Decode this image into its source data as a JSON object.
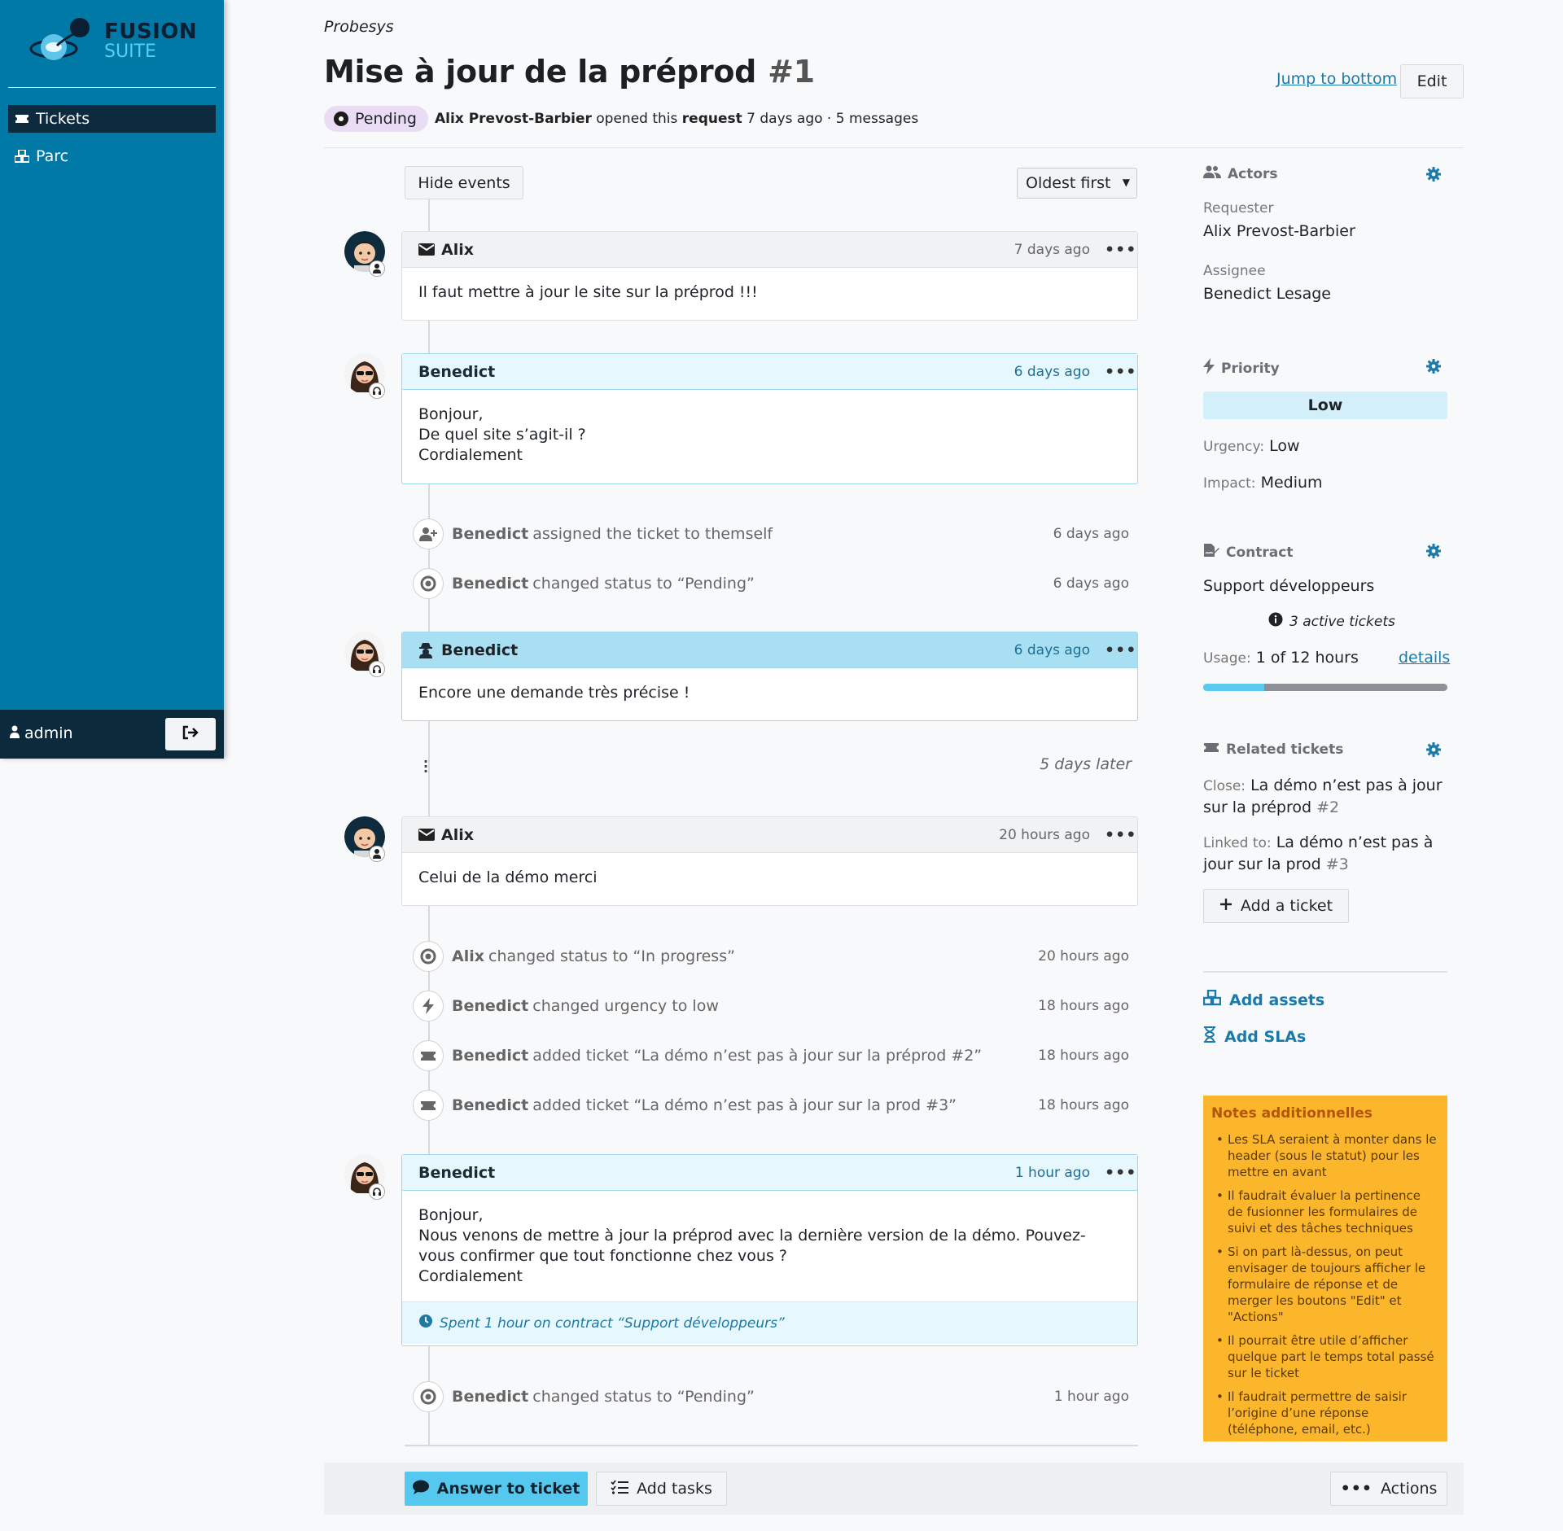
{
  "app": {
    "logo_line1": "FUSION",
    "logo_line2": "SUITE"
  },
  "sidebar": {
    "items": [
      {
        "label": "Tickets",
        "icon": "ticket-icon",
        "active": true
      },
      {
        "label": "Parc",
        "icon": "cubes-icon",
        "active": false
      }
    ],
    "user": "admin"
  },
  "header": {
    "breadcrumb": "Probesys",
    "title": "Mise à jour de la préprod",
    "number": "#1",
    "jump_label": "Jump to bottom",
    "edit_label": "Edit",
    "status": "Pending",
    "author": "Alix Prevost-Barbier",
    "opened_text": "opened this",
    "type": "request",
    "opened_when": "7 days ago · 5 messages"
  },
  "timeline": {
    "hide_events_label": "Hide events",
    "sort_value": "Oldest first",
    "messages": [
      {
        "author": "Alix",
        "time": "7 days ago",
        "lines": [
          "Il faut mettre à jour le site sur la préprod !!!"
        ]
      },
      {
        "author": "Benedict",
        "time": "6 days ago",
        "lines": [
          "Bonjour,",
          "De quel site s’agit-il ?",
          "Cordialement"
        ]
      },
      {
        "author": "Benedict",
        "time": "6 days ago",
        "lines": [
          "Encore une demande très précise !"
        ]
      },
      {
        "author": "Alix",
        "time": "20 hours ago",
        "lines": [
          "Celui de la démo merci"
        ]
      },
      {
        "author": "Benedict",
        "time": "1 hour ago",
        "lines": [
          "Bonjour,",
          "Nous venons de mettre à jour la préprod avec la dernière version de la démo. Pouvez-vous confirmer que tout fonctionne chez vous ?",
          "Cordialement"
        ],
        "footer": "Spent 1 hour on contract “Support développeurs”"
      }
    ],
    "events": [
      {
        "actor": "Benedict",
        "text": "assigned the ticket to themself",
        "time": "6 days ago",
        "icon": "user-plus-icon"
      },
      {
        "actor": "Benedict",
        "text": "changed status to “Pending”",
        "time": "6 days ago",
        "icon": "status-circle-icon"
      },
      {
        "actor": "Alix",
        "text": "changed status to “In progress”",
        "time": "20 hours ago",
        "icon": "status-circle-icon"
      },
      {
        "actor": "Benedict",
        "text": "changed urgency to low",
        "time": "18 hours ago",
        "icon": "bolt-icon"
      },
      {
        "actor": "Benedict",
        "text": "added ticket “La démo n’est pas à jour sur la préprod #2”",
        "time": "18 hours ago",
        "icon": "ticket-icon"
      },
      {
        "actor": "Benedict",
        "text": "added ticket “La démo n’est pas à jour sur la prod #3”",
        "time": "18 hours ago",
        "icon": "ticket-icon"
      },
      {
        "actor": "Benedict",
        "text": "changed status to “Pending”",
        "time": "1 hour ago",
        "icon": "status-circle-icon"
      }
    ],
    "gap_label": "5 days later"
  },
  "actionbar": {
    "answer_label": "Answer to ticket",
    "tasks_label": "Add tasks",
    "actions_label": "Actions"
  },
  "right_panel": {
    "actors": {
      "title": "Actors",
      "requester_label": "Requester",
      "requester": "Alix Prevost-Barbier",
      "assignee_label": "Assignee",
      "assignee": "Benedict Lesage"
    },
    "priority": {
      "title": "Priority",
      "value": "Low",
      "urgency_label": "Urgency:",
      "urgency": "Low",
      "impact_label": "Impact:",
      "impact": "Medium"
    },
    "contract": {
      "title": "Contract",
      "name": "Support développeurs",
      "active_tickets": "3 active tickets",
      "usage_label": "Usage:",
      "usage": "1 of 12 hours",
      "usage_fraction": 0.25,
      "details_label": "details"
    },
    "related": {
      "title": "Related tickets",
      "close_label": "Close:",
      "close_title": "La démo n’est pas à jour sur la préprod",
      "close_ref": "#2",
      "linked_label": "Linked to:",
      "linked_title": "La démo n’est pas à jour sur la prod",
      "linked_ref": "#3",
      "add_label": "Add a ticket"
    },
    "add_assets": "Add assets",
    "add_slas": "Add SLAs",
    "notes": {
      "title": "Notes additionnelles",
      "items": [
        "Les SLA seraient à monter dans le header (sous le statut) pour les mettre en avant",
        "Il faudrait évaluer la pertinence de fusionner les formulaires de suivi et des tâches techniques",
        "Si on part là-dessus, on peut envisager de toujours afficher le formulaire de réponse et de merger les boutons \"Edit\" et \"Actions\"",
        "Il pourrait être utile d’afficher quelque part le temps total passé sur le ticket",
        "Il faudrait permettre de saisir l’origine d’une réponse (téléphone, email, etc.)"
      ]
    }
  },
  "colors": {
    "sidebar": "#0079a6",
    "accent": "#54c8ee",
    "link": "#1a7aaa",
    "status_badge": "#eadcf5",
    "notes_bg": "#fcb62b"
  }
}
